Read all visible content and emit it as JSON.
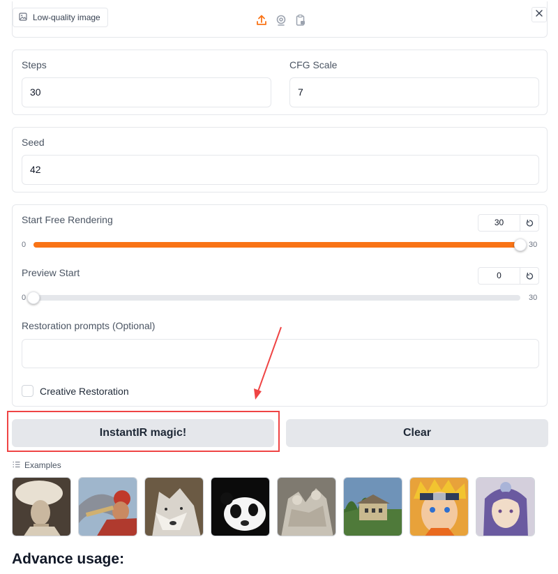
{
  "upload": {
    "label": "Low-quality image"
  },
  "fields": {
    "steps_label": "Steps",
    "steps_value": "30",
    "cfg_label": "CFG Scale",
    "cfg_value": "7",
    "seed_label": "Seed",
    "seed_value": "42"
  },
  "sliders": {
    "free_render": {
      "label": "Start Free Rendering",
      "value": "30",
      "min": "0",
      "max": "30",
      "fraction": 1.0
    },
    "preview": {
      "label": "Preview Start",
      "value": "0",
      "min": "0",
      "max": "30",
      "fraction": 0.0
    }
  },
  "prompt": {
    "label": "Restoration prompts (Optional)",
    "value": ""
  },
  "creative": {
    "label": "Creative Restoration",
    "checked": false
  },
  "buttons": {
    "run": "InstantIR magic!",
    "clear": "Clear"
  },
  "examples": {
    "label": "Examples",
    "items": [
      "vintage-portrait",
      "trumpet-player",
      "wolf",
      "panda",
      "statue-relief",
      "stone-house",
      "naruto",
      "konan"
    ]
  },
  "heading": "Advance usage:",
  "colors": {
    "accent": "#f97316",
    "annotation": "#ef4444"
  }
}
